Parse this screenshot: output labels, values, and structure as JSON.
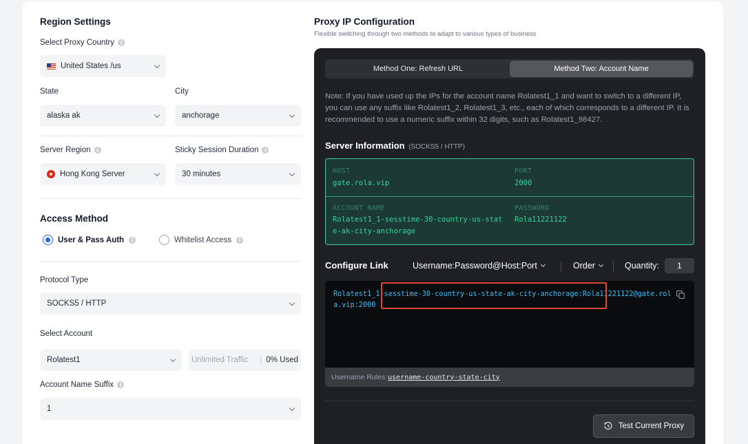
{
  "region": {
    "title": "Region Settings",
    "country_label": "Select Proxy Country",
    "country_value": "United States /us",
    "state_label": "State",
    "state_value": "alaska ak",
    "city_label": "City",
    "city_value": "anchorage",
    "server_region_label": "Server Region",
    "server_region_value": "Hong Kong Server",
    "sticky_label": "Sticky Session Duration",
    "sticky_value": "30 minutes"
  },
  "access": {
    "title": "Access Method",
    "option1": "User & Pass Auth",
    "option2": "Whitelist Access",
    "selected": "User & Pass Auth",
    "protocol_label": "Protocol Type",
    "protocol_value": "SOCKS5 / HTTP",
    "account_label": "Select Account",
    "account_value": "Rolatest1",
    "traffic_placeholder": "Unlimited Traffic",
    "traffic_used": "0% Used",
    "suffix_label": "Account Name Suffix",
    "suffix_value": "1"
  },
  "proxy": {
    "title": "Proxy IP Configuration",
    "subtitle": "Flexible switching through two methods to adapt to various types of business",
    "tab1": "Method One: Refresh URL",
    "tab2": "Method Two: Account Name",
    "active_tab": "Method Two: Account Name",
    "note": "Note: If you have used up the IPs for the account name Rolatest1_1 and want to switch to a different IP, you can use any suffix like Rolatest1_2, Rolatest1_3, etc., each of which corresponds to a different IP. It is recommended to use a numeric suffix within 32 digits, such as Rolatest1_98427.",
    "server_info_title": "Server Information",
    "server_info_sub": "(SOCKS5 / HTTP)",
    "host_key": "HOST",
    "host_value": "gate.rola.vip",
    "port_key": "PORT",
    "port_value": "2000",
    "account_key": "ACCOUNT NAME",
    "account_value": "Rolatest1_1-sesstime-30-country-us-state-ak-city-anchorage",
    "password_key": "PASSWORD",
    "password_value": "Rola11221122",
    "configure_title": "Configure Link",
    "format_value": "Username:Password@Host:Port",
    "order_label": "Order",
    "quantity_label": "Quantity:",
    "quantity_value": "1",
    "link_text": "Rolatest1_1-sesstime-30-country-us-state-ak-city-anchorage:Rola11221122@gate.rola.vip:2000",
    "rules_label": "Username Rules:",
    "rules_value": "username-country-state-city",
    "test_button": "Test Current Proxy"
  },
  "colors": {
    "accent": "#2563eb",
    "panel_dark": "#1f2023",
    "server_green": "#34d399",
    "link_blue": "#38bdf8",
    "highlight_red": "#d9483b"
  },
  "icons": [
    "info-icon",
    "us-flag-icon",
    "hk-flag-icon",
    "chevron-down-icon",
    "copy-icon",
    "refresh-icon"
  ]
}
